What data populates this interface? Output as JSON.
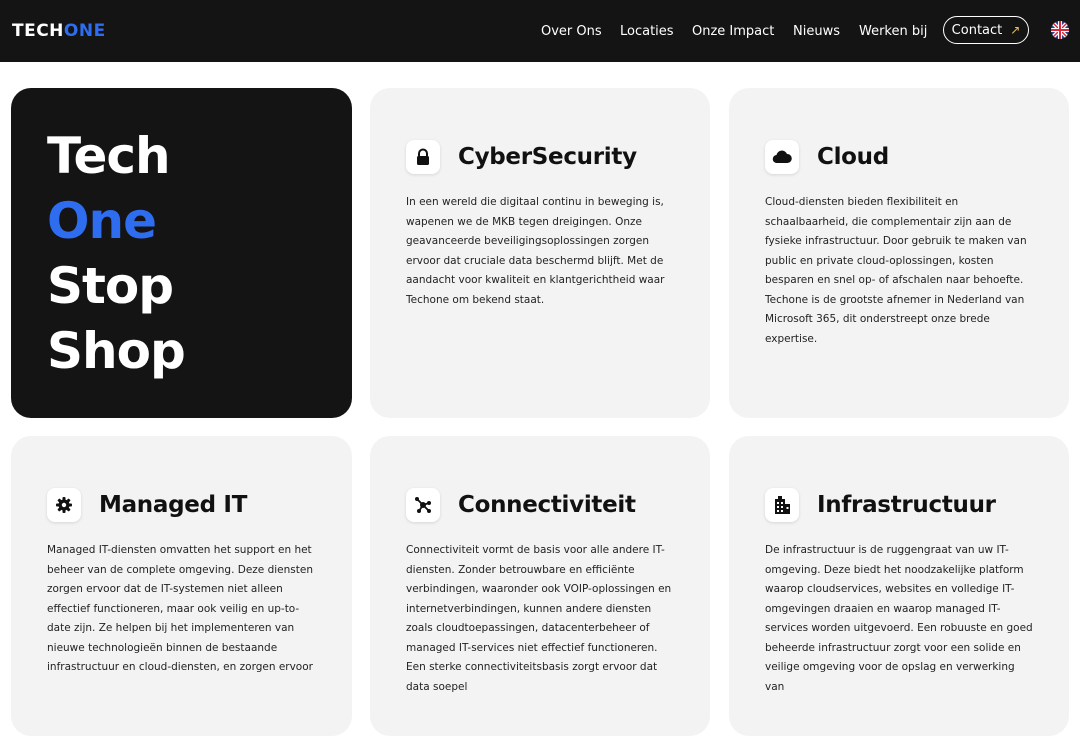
{
  "header": {
    "logo_part1": "TECH",
    "logo_part2": "ONE",
    "nav": [
      "Over Ons",
      "Locaties",
      "Onze Impact",
      "Nieuws",
      "Werken bij"
    ],
    "contact_label": "Contact",
    "contact_icon": "arrow-up-right-icon",
    "language_icon": "uk-flag-icon"
  },
  "hero": {
    "line1": "Tech",
    "line2": "One",
    "line3": "Stop",
    "line4": "Shop"
  },
  "services": [
    {
      "title": "CyberSecurity",
      "icon": "lock-icon",
      "text": "In een wereld die digitaal continu in beweging is, wapenen we de MKB tegen dreigingen. Onze geavanceerde beveiligingsoplossingen zorgen ervoor dat cruciale data beschermd blijft. Met de aandacht voor kwaliteit en klantgerichtheid waar Techone om bekend staat."
    },
    {
      "title": "Cloud",
      "icon": "cloud-icon",
      "text": "Cloud-diensten bieden flexibiliteit en schaalbaarheid, die complementair zijn aan de fysieke infrastructuur. Door gebruik te maken van public en private cloud-oplossingen, kosten besparen en snel op- of afschalen naar behoefte. Techone is de grootste afnemer in Nederland van Microsoft 365, dit onderstreept onze brede expertise."
    },
    {
      "title": "Managed IT",
      "icon": "gear-icon",
      "text": "Managed IT-diensten omvatten het support en het beheer van de complete omgeving. Deze diensten zorgen ervoor dat de IT-systemen niet alleen effectief functioneren, maar ook veilig en up-to-date zijn. Ze helpen bij het implementeren van nieuwe technologieën binnen de bestaande infrastructuur en cloud-diensten, en zorgen ervoor"
    },
    {
      "title": "Connectiviteit",
      "icon": "network-nodes-icon",
      "text": "Connectiviteit vormt de basis voor alle andere IT-diensten. Zonder betrouwbare en efficiënte verbindingen, waaronder ook VOIP-oplossingen en internetverbindingen, kunnen andere diensten zoals cloudtoepassingen, datacenterbeheer of managed IT-services niet effectief functioneren. Een sterke connectiviteitsbasis zorgt ervoor dat data soepel"
    },
    {
      "title": "Infrastructuur",
      "icon": "building-icon",
      "text": "De infrastructuur is de ruggengraat van uw IT-omgeving. Deze biedt het noodzakelijke platform waarop cloudservices, websites en volledige IT-omgevingen draaien en waarop managed IT-services worden uitgevoerd. Een robuuste en goed beheerde infrastructuur zorgt voor een solide en veilige omgeving voor de opslag en verwerking van"
    }
  ],
  "colors": {
    "dark": "#141414",
    "accent_blue": "#2f6df0",
    "card_bg": "#f3f3f3",
    "contact_arrow": "#f2c14e"
  }
}
